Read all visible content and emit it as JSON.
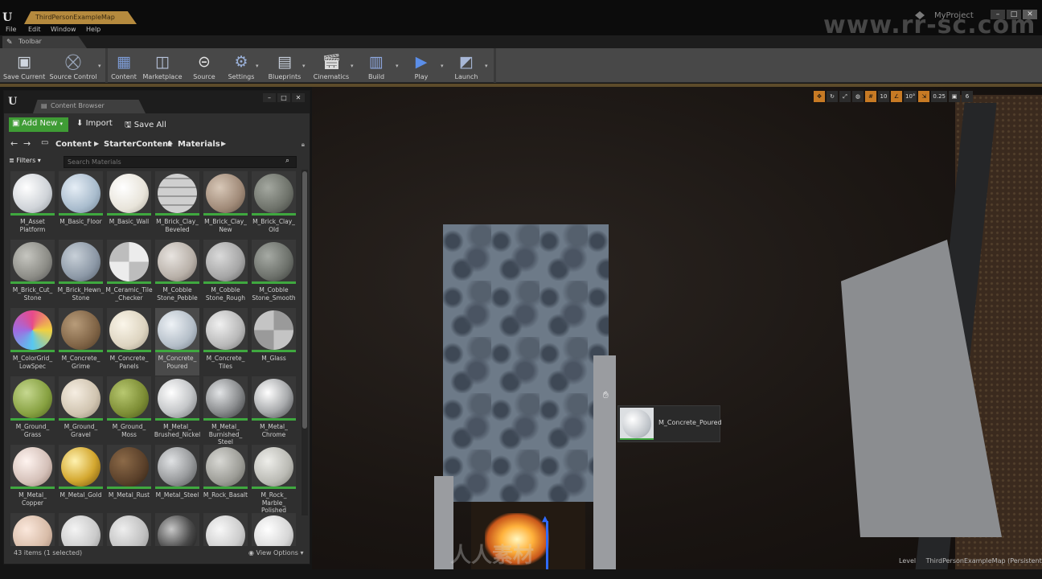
{
  "title_bar": {
    "tab_title": "ThirdPersonExampleMap",
    "project_name": "MyProject",
    "window_buttons": [
      "–",
      "□",
      "✕"
    ]
  },
  "menu": [
    "File",
    "Edit",
    "Window",
    "Help"
  ],
  "toolbar_tab": "Toolbar",
  "toolbar": [
    {
      "label": "Save Current",
      "icon": "save-icon"
    },
    {
      "label": "Source Control",
      "icon": "source-control-icon"
    },
    {
      "label": "Content",
      "icon": "content-icon"
    },
    {
      "label": "Marketplace",
      "icon": "marketplace-icon"
    },
    {
      "label": "Source",
      "icon": "source-icon"
    },
    {
      "label": "Settings",
      "icon": "settings-icon"
    },
    {
      "label": "Blueprints",
      "icon": "blueprints-icon"
    },
    {
      "label": "Cinematics",
      "icon": "cinematics-icon"
    },
    {
      "label": "Build",
      "icon": "build-icon"
    },
    {
      "label": "Play",
      "icon": "play-icon"
    },
    {
      "label": "Launch",
      "icon": "launch-icon"
    }
  ],
  "viewport": {
    "tools": [
      "10",
      "10°",
      "0.25",
      "6"
    ],
    "drag_tooltip": "M_Concrete_Poured",
    "level_label": "Level",
    "level_name": "ThirdPersonExampleMap (Persistent)",
    "accent": "#c77a24"
  },
  "content_browser": {
    "tab_title": "Content Browser",
    "add_new": "Add New",
    "import": "Import",
    "save_all": "Save All",
    "breadcrumbs": [
      "Content",
      "StarterContent",
      "Materials"
    ],
    "filters": "Filters",
    "search_placeholder": "Search Materials",
    "status": "43 items (1 selected)",
    "view_options": "View Options",
    "items": [
      {
        "label": "M_Asset\nPlatform"
      },
      {
        "label": "M_Basic_Floor"
      },
      {
        "label": "M_Basic_Wall"
      },
      {
        "label": "M_Brick_Clay_\nBeveled"
      },
      {
        "label": "M_Brick_Clay_\nNew"
      },
      {
        "label": "M_Brick_Clay_\nOld"
      },
      {
        "label": "M_Brick_Cut_\nStone"
      },
      {
        "label": "M_Brick_Hewn_\nStone"
      },
      {
        "label": "M_Ceramic_Tile\n_Checker"
      },
      {
        "label": "M_Cobble\nStone_Pebble"
      },
      {
        "label": "M_Cobble\nStone_Rough"
      },
      {
        "label": "M_Cobble\nStone_Smooth"
      },
      {
        "label": "M_ColorGrid_\nLowSpec"
      },
      {
        "label": "M_Concrete_\nGrime"
      },
      {
        "label": "M_Concrete_\nPanels"
      },
      {
        "label": "M_Concrete_\nPoured",
        "selected": true
      },
      {
        "label": "M_Concrete_\nTiles"
      },
      {
        "label": "M_Glass"
      },
      {
        "label": "M_Ground_\nGrass"
      },
      {
        "label": "M_Ground_\nGravel"
      },
      {
        "label": "M_Ground_\nMoss"
      },
      {
        "label": "M_Metal_\nBrushed_Nickel"
      },
      {
        "label": "M_Metal_\nBurnished_\nSteel"
      },
      {
        "label": "M_Metal_\nChrome"
      },
      {
        "label": "M_Metal_\nCopper"
      },
      {
        "label": "M_Metal_Gold"
      },
      {
        "label": "M_Metal_Rust"
      },
      {
        "label": "M_Metal_Steel"
      },
      {
        "label": "M_Rock_Basalt"
      },
      {
        "label": "M_Rock_\nMarble_\nPolished"
      },
      {
        "label": ""
      },
      {
        "label": ""
      },
      {
        "label": ""
      },
      {
        "label": ""
      },
      {
        "label": ""
      },
      {
        "label": ""
      }
    ]
  },
  "watermark": "www.rr-sc.com",
  "watermark_bottom": "人人素材"
}
